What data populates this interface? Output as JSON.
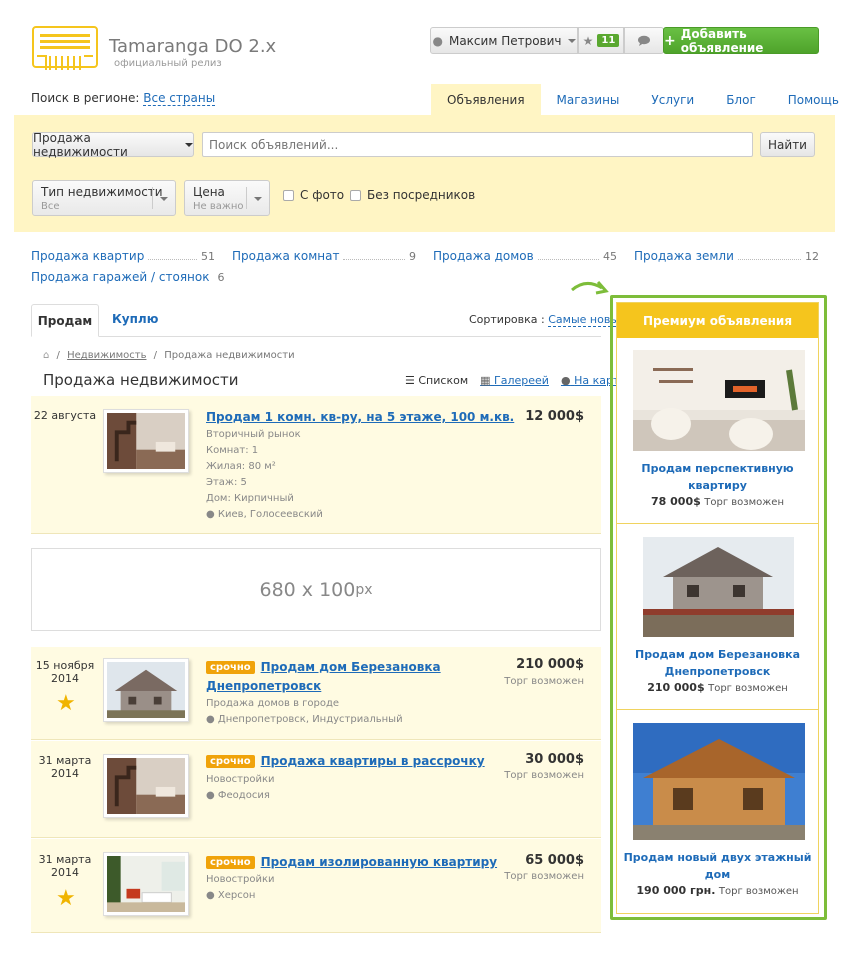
{
  "header": {
    "brand": "Tamaranga DO 2.x",
    "subtitle": "официальный релиз",
    "user_name": "Максим Петрович",
    "favorites_count": "11",
    "add_button": "Добавить объявление"
  },
  "region": {
    "label": "Поиск в регионе:",
    "value": "Все страны"
  },
  "nav": [
    "Объявления",
    "Магазины",
    "Услуги",
    "Блог",
    "Помощь"
  ],
  "search": {
    "category": "Продажа недвижимости",
    "placeholder": "Поиск объявлений...",
    "button": "Найти",
    "filters": [
      {
        "title": "Тип недвижимости",
        "value": "Все"
      },
      {
        "title": "Цена",
        "value": "Не важно"
      }
    ],
    "checkboxes": [
      "С фото",
      "Без посредников"
    ]
  },
  "categories": [
    {
      "name": "Продажа квартир",
      "count": "51"
    },
    {
      "name": "Продажа комнат",
      "count": "9"
    },
    {
      "name": "Продажа домов",
      "count": "45"
    },
    {
      "name": "Продажа земли",
      "count": "12"
    },
    {
      "name": "Продажа гаражей / стоянок",
      "count": "6"
    }
  ],
  "tabs": {
    "sell": "Продам",
    "buy": "Куплю"
  },
  "sort": {
    "label": "Сортировка :",
    "value": "Самые новые"
  },
  "breadcrumb": {
    "link": "Недвижимость",
    "current": "Продажа недвижимости"
  },
  "page_title": "Продажа недвижимости",
  "views": {
    "list": "Списком",
    "gallery": "Галереей",
    "map": "На карте"
  },
  "listings": [
    {
      "date": "22 августа",
      "title": "Продам 1 комн. кв-ру, на 5 этаже, 100 м.кв.",
      "price": "12 000$",
      "details": [
        "Вторичный рынок",
        "Комнат: 1",
        "Жилая: 80 м²",
        "Этаж: 5",
        "Дом: Кирпичный"
      ],
      "location": "Киев, Голосеевский"
    },
    {
      "date": "15 ноября",
      "year": "2014",
      "urgent": "срочно",
      "title": "Продам дом Березановка",
      "title2": "Днепропетровск",
      "price": "210 000$",
      "torg": "Торг возможен",
      "details": [
        "Продажа домов в городе"
      ],
      "location": "Днепропетровск, Индустриальный"
    },
    {
      "date": "31 марта",
      "year": "2014",
      "urgent": "срочно",
      "title": "Продажа квартиры в рассрочку",
      "price": "30 000$",
      "torg": "Торг возможен",
      "details": [
        "Новостройки"
      ],
      "location": "Феодосия"
    },
    {
      "date": "31 марта",
      "year": "2014",
      "urgent": "срочно",
      "title": "Продам изолированную квартиру",
      "price": "65 000$",
      "torg": "Торг возможен",
      "details": [
        "Новостройки"
      ],
      "location": "Херсон"
    }
  ],
  "banner": {
    "size": "680 x 100",
    "unit": "px"
  },
  "premium": {
    "title": "Премиум объявления",
    "items": [
      {
        "title1": "Продам перспективную",
        "title2": "квартиру",
        "price": "78 000$",
        "torg": "Торг возможен"
      },
      {
        "title1": "Продам дом Березановка",
        "title2": "Днепропетровск",
        "price": "210 000$",
        "torg": "Торг возможен"
      },
      {
        "title1": "Продам новый двух этажный",
        "title2": "дом",
        "price": "190 000 грн.",
        "torg": "Торг возможен"
      }
    ]
  },
  "colors": {
    "accent": "#1e6bb8",
    "green": "#5aa830",
    "yellow": "#f5c51d",
    "panel": "#fff5c4"
  }
}
